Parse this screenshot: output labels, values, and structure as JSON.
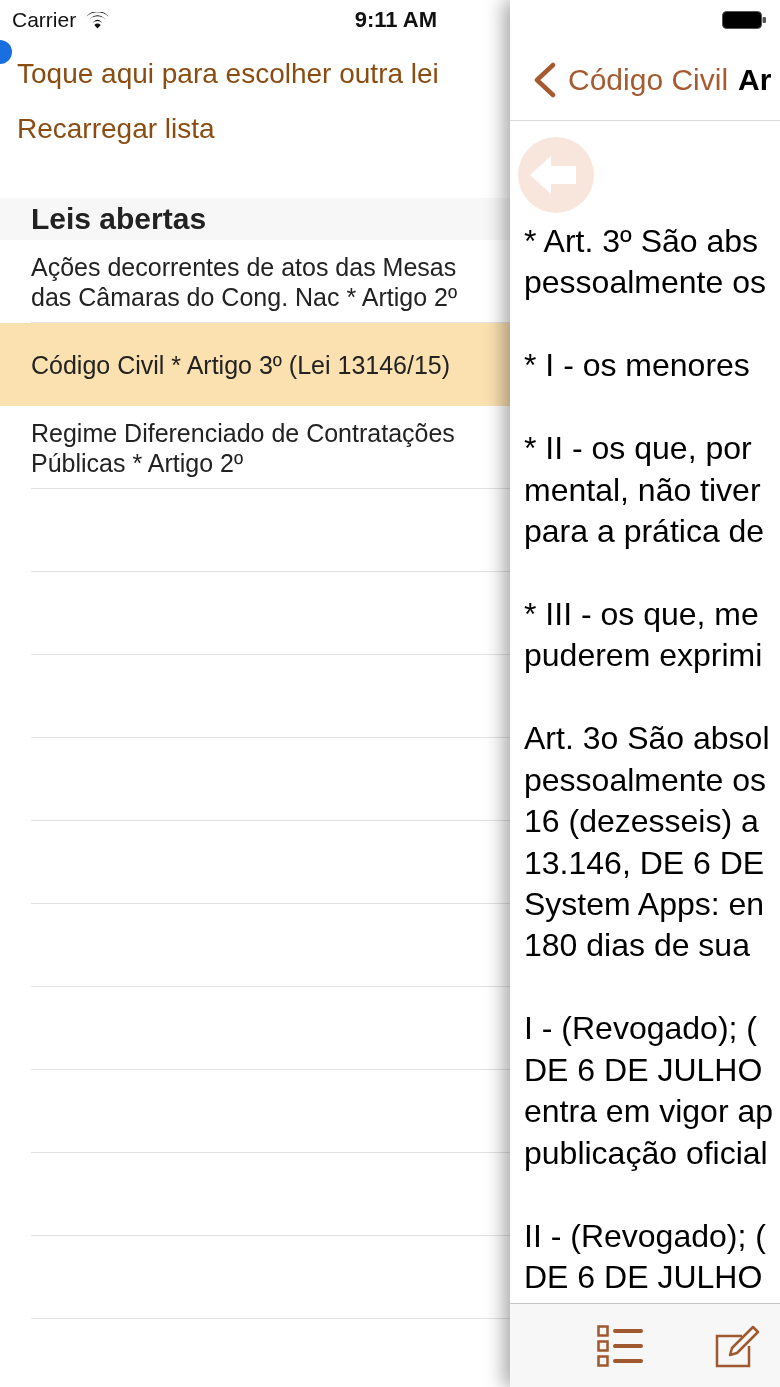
{
  "status_bar": {
    "carrier": "Carrier",
    "time": "9:11 AM"
  },
  "actions": [
    {
      "label": "Toque aqui para escolher outra lei"
    },
    {
      "label": "Recarregar lista"
    }
  ],
  "open_laws": {
    "title": "Leis abertas",
    "items": [
      {
        "label": "Ações decorrentes de atos das Mesas das Câmaras do Cong. Nac * Artigo 2º",
        "selected": false
      },
      {
        "label": "Código Civil * Artigo 3º (Lei 13146/15)",
        "selected": true
      },
      {
        "label": "Regime Diferenciado de Contratações Públicas * Artigo 2º",
        "selected": false
      }
    ]
  },
  "reader": {
    "back_label": "Código Civil",
    "title": "Ar",
    "paragraphs": [
      {
        "lines": [
          "* Art. 3º São abs",
          "pessoalmente os"
        ]
      },
      {
        "lines": [
          "* I - os menores"
        ]
      },
      {
        "lines": [
          "* II - os que, por",
          "mental, não tiver",
          "para a prática de"
        ]
      },
      {
        "lines": [
          "* III - os que, me",
          "puderem exprimi"
        ]
      },
      {
        "lines": [
          "Art. 3o São absol",
          "pessoalmente os",
          "16 (dezesseis) a",
          "13.146, DE 6 DE",
          "System Apps: en",
          "180 dias de sua"
        ]
      },
      {
        "lines": [
          "I - (Revogado); (",
          "DE 6 DE JULHO",
          "entra em vigor ap",
          "publicação oficial"
        ]
      },
      {
        "lines": [
          "II - (Revogado); (",
          "DE 6 DE JULHO"
        ]
      }
    ]
  }
}
